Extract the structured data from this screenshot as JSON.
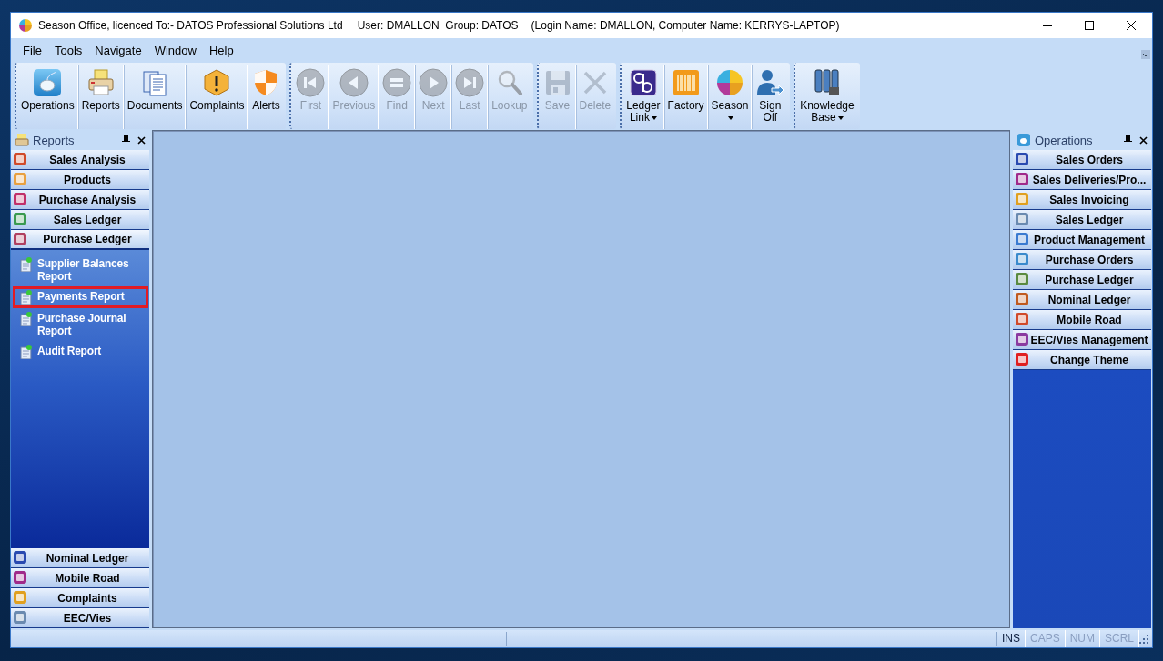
{
  "window": {
    "title": "Season Office, licenced To:- DATOS Professional Solutions Ltd",
    "user_info": "User: DMALLON  Group: DATOS",
    "login_info": "(Login Name: DMALLON, Computer Name: KERRYS-LAPTOP)"
  },
  "menu": [
    "File",
    "Tools",
    "Navigate",
    "Window",
    "Help"
  ],
  "toolbar_groups": [
    {
      "buttons": [
        {
          "label": "Operations",
          "disabled": false,
          "dropdown": false
        },
        {
          "label": "Reports",
          "disabled": false,
          "dropdown": false
        },
        {
          "label": "Documents",
          "disabled": false,
          "dropdown": false
        },
        {
          "label": "Complaints",
          "disabled": false,
          "dropdown": false
        },
        {
          "label": "Alerts",
          "disabled": false,
          "dropdown": false
        }
      ]
    },
    {
      "buttons": [
        {
          "label": "First",
          "disabled": true,
          "dropdown": false
        },
        {
          "label": "Previous",
          "disabled": true,
          "dropdown": false
        },
        {
          "label": "Find",
          "disabled": true,
          "dropdown": false
        },
        {
          "label": "Next",
          "disabled": true,
          "dropdown": false
        },
        {
          "label": "Last",
          "disabled": true,
          "dropdown": false
        },
        {
          "label": "Lookup",
          "disabled": true,
          "dropdown": false
        }
      ]
    },
    {
      "buttons": [
        {
          "label": "Save",
          "disabled": true,
          "dropdown": false
        },
        {
          "label": "Delete",
          "disabled": true,
          "dropdown": false
        }
      ]
    },
    {
      "buttons": [
        {
          "label": "Ledger Link",
          "disabled": false,
          "dropdown": true
        },
        {
          "label": "Factory",
          "disabled": false,
          "dropdown": false
        },
        {
          "label": "Season",
          "disabled": false,
          "dropdown": true
        },
        {
          "label": "Sign Off",
          "disabled": false,
          "dropdown": false
        }
      ]
    },
    {
      "buttons": [
        {
          "label": "Knowledge Base",
          "disabled": false,
          "dropdown": true
        }
      ]
    }
  ],
  "reports_panel": {
    "title": "Reports",
    "sections": [
      {
        "label": "Sales Analysis",
        "expanded": false
      },
      {
        "label": "Products",
        "expanded": false
      },
      {
        "label": "Purchase Analysis",
        "expanded": false
      },
      {
        "label": "Sales Ledger",
        "expanded": false
      },
      {
        "label": "Purchase Ledger",
        "expanded": true,
        "items": [
          {
            "label": "Supplier Balances Report",
            "selected": false
          },
          {
            "label": "Payments Report",
            "selected": true
          },
          {
            "label": "Purchase Journal Report",
            "selected": false
          },
          {
            "label": "Audit Report",
            "selected": false
          }
        ]
      },
      {
        "label": "Nominal Ledger",
        "expanded": false
      },
      {
        "label": "Mobile Road",
        "expanded": false
      },
      {
        "label": "Complaints",
        "expanded": false
      },
      {
        "label": "EEC/Vies",
        "expanded": false
      }
    ]
  },
  "operations_panel": {
    "title": "Operations",
    "items": [
      "Sales Orders",
      "Sales Deliveries/Pro...",
      "Sales Invoicing",
      "Sales Ledger",
      "Product Management",
      "Purchase Orders",
      "Purchase Ledger",
      "Nominal Ledger",
      "Mobile Road",
      "EEC/Vies Management",
      "Change Theme"
    ]
  },
  "status_bar": {
    "indicators": [
      {
        "label": "INS",
        "on": true
      },
      {
        "label": "CAPS",
        "on": false
      },
      {
        "label": "NUM",
        "on": false
      },
      {
        "label": "SCRL",
        "on": false
      }
    ]
  }
}
